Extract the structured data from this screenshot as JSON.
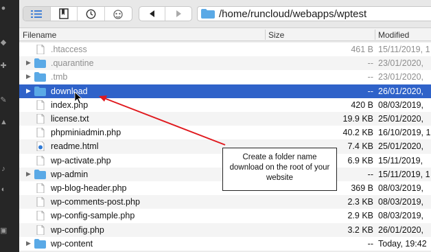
{
  "toolbar": {
    "view_buttons": [
      "list-view-icon",
      "bookmark-icon",
      "recent-clock-icon",
      "connections-icon"
    ],
    "nav_buttons": [
      "back-icon",
      "forward-icon"
    ],
    "path": "/home/runcloud/webapps/wptest"
  },
  "columns": {
    "filename": "Filename",
    "size": "Size",
    "modified": "Modified"
  },
  "files": [
    {
      "name": ".htaccess",
      "size": "461 B",
      "modified": "15/11/2019, 1",
      "type": "file"
    },
    {
      "name": ".quarantine",
      "size": "--",
      "modified": "23/01/2020,",
      "type": "folder"
    },
    {
      "name": ".tmb",
      "size": "--",
      "modified": "23/01/2020,",
      "type": "folder"
    },
    {
      "name": "download",
      "size": "--",
      "modified": "26/01/2020,",
      "type": "folder",
      "selected": true
    },
    {
      "name": "index.php",
      "size": "420 B",
      "modified": "08/03/2019,",
      "type": "file"
    },
    {
      "name": "license.txt",
      "size": "19.9 KB",
      "modified": "25/01/2020,",
      "type": "file"
    },
    {
      "name": "phpminiadmin.php",
      "size": "40.2 KB",
      "modified": "16/10/2019, 1",
      "type": "file"
    },
    {
      "name": "readme.html",
      "size": "7.4 KB",
      "modified": "25/01/2020,",
      "type": "html"
    },
    {
      "name": "wp-activate.php",
      "size": "6.9 KB",
      "modified": "15/11/2019,",
      "type": "file"
    },
    {
      "name": "wp-admin",
      "size": "--",
      "modified": "15/11/2019, 1",
      "type": "folder"
    },
    {
      "name": "wp-blog-header.php",
      "size": "369 B",
      "modified": "08/03/2019,",
      "type": "file"
    },
    {
      "name": "wp-comments-post.php",
      "size": "2.3 KB",
      "modified": "08/03/2019,",
      "type": "file"
    },
    {
      "name": "wp-config-sample.php",
      "size": "2.9 KB",
      "modified": "08/03/2019,",
      "type": "file"
    },
    {
      "name": "wp-config.php",
      "size": "3.2 KB",
      "modified": "26/01/2020,",
      "type": "file"
    },
    {
      "name": "wp-content",
      "size": "--",
      "modified": "Today, 19:42",
      "type": "folder"
    }
  ],
  "annotation": {
    "text": "Create a folder name download on the root of your website",
    "arrow_color": "#e0191e"
  },
  "colors": {
    "selection": "#2f62c9",
    "folder": "#5aa9e6"
  }
}
